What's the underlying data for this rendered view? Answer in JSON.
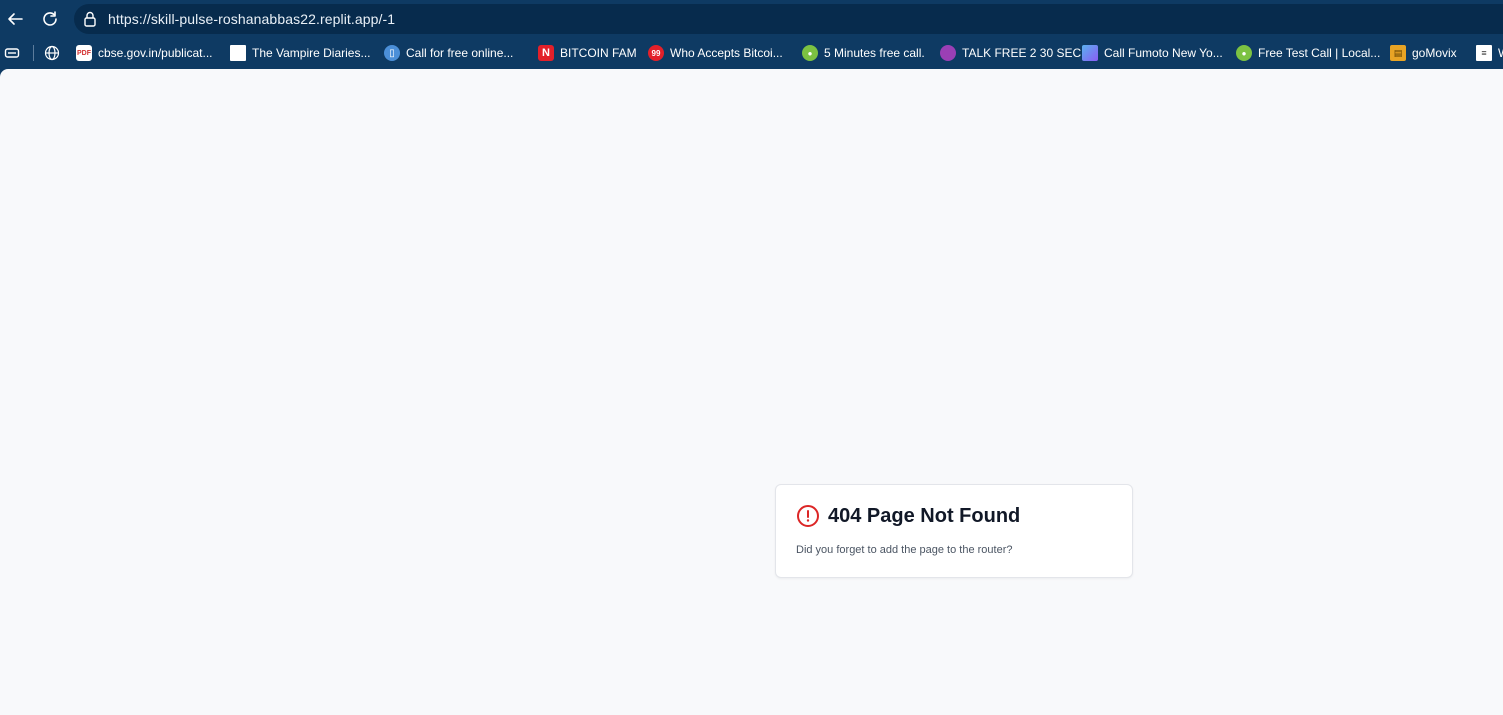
{
  "browser": {
    "url": "https://skill-pulse-roshanabbas22.replit.app/-1",
    "bookmarks": [
      {
        "label": "cbse.gov.in/publicat...",
        "icon": "pdf-icon"
      },
      {
        "label": "The Vampire Diaries...",
        "icon": "blank-page-icon"
      },
      {
        "label": "Call for free online...",
        "icon": "phone-app-icon"
      },
      {
        "label": "BITCOIN FAM",
        "icon": "n-logo-icon"
      },
      {
        "label": "Who Accepts Bitcoi...",
        "icon": "99-badge-icon"
      },
      {
        "label": "5 Minutes free call.",
        "icon": "chat-bubble-icon"
      },
      {
        "label": "TALK FREE 2 30 SEC",
        "icon": "purple-chat-icon"
      },
      {
        "label": "Call Fumoto New Yo...",
        "icon": "chart-icon"
      },
      {
        "label": "Free Test Call | Local...",
        "icon": "chat-bubble-icon"
      },
      {
        "label": "goMovix",
        "icon": "film-icon"
      },
      {
        "label": "W",
        "icon": "document-icon"
      }
    ]
  },
  "error": {
    "title": "404 Page Not Found",
    "message": "Did you forget to add the page to the router?"
  },
  "colors": {
    "chrome": "#0e3a63",
    "page_bg": "#f8f9fb",
    "alert": "#dc2626"
  }
}
